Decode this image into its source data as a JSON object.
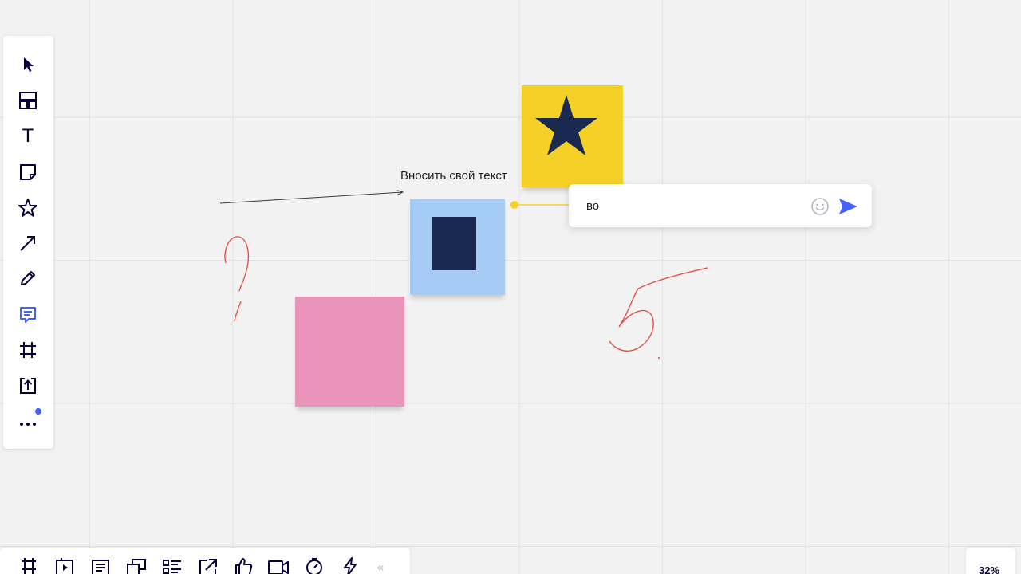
{
  "canvas": {
    "background_color": "#f2f2f2",
    "grid_color": "#e3e3e3"
  },
  "left_toolbar": {
    "tools": [
      {
        "name": "select",
        "icon": "cursor-arrow-icon",
        "active": false
      },
      {
        "name": "templates",
        "icon": "templates-icon",
        "active": false
      },
      {
        "name": "text",
        "icon": "text-icon",
        "glyph": "T",
        "active": false
      },
      {
        "name": "sticky-note",
        "icon": "sticky-note-icon",
        "active": false
      },
      {
        "name": "shapes",
        "icon": "star-icon",
        "active": false
      },
      {
        "name": "connection-line",
        "icon": "arrow-line-icon",
        "active": false
      },
      {
        "name": "pen",
        "icon": "pen-icon",
        "active": false
      },
      {
        "name": "comment",
        "icon": "comment-icon",
        "active": true
      },
      {
        "name": "frame",
        "icon": "frame-icon",
        "active": false
      },
      {
        "name": "upload",
        "icon": "upload-icon",
        "active": false
      },
      {
        "name": "more",
        "icon": "more-dots-icon",
        "active": false,
        "has_badge": true
      }
    ],
    "active_color": "#4262ff",
    "icon_color": "#050038"
  },
  "bottom_toolbar": {
    "tools": [
      {
        "name": "frames",
        "icon": "frames-icon"
      },
      {
        "name": "presentation",
        "icon": "presentation-icon"
      },
      {
        "name": "notes",
        "icon": "notes-icon"
      },
      {
        "name": "cards",
        "icon": "cards-icon"
      },
      {
        "name": "kanban",
        "icon": "kanban-icon"
      },
      {
        "name": "share",
        "icon": "share-arrow-icon"
      },
      {
        "name": "vote",
        "icon": "thumbs-up-icon"
      },
      {
        "name": "video",
        "icon": "video-camera-icon"
      },
      {
        "name": "timer",
        "icon": "timer-icon"
      },
      {
        "name": "power-ups",
        "icon": "lightning-icon"
      }
    ],
    "collapse_glyph": "«"
  },
  "zoom": {
    "level": "32%"
  },
  "board": {
    "text_label": "Вносить свой текст",
    "sticky_colors": {
      "yellow": "#f5d128",
      "blue": "#a6ccf5",
      "pink": "#ea94bb"
    },
    "shape_color": "#1a2950",
    "ink_color": "#e2493c",
    "connector_color": "#f5d128"
  },
  "comment": {
    "value": "во",
    "send_color": "#4262ff"
  }
}
